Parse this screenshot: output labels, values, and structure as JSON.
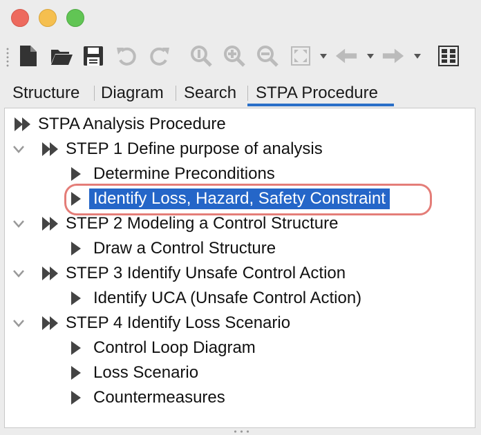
{
  "window": {
    "title_lights": [
      "close",
      "minimize",
      "zoom"
    ]
  },
  "toolbar": {
    "buttons": [
      {
        "name": "new-file-icon",
        "enabled": true
      },
      {
        "name": "open-folder-icon",
        "enabled": true
      },
      {
        "name": "save-icon",
        "enabled": true
      },
      {
        "name": "undo-icon",
        "enabled": false
      },
      {
        "name": "redo-icon",
        "enabled": false
      },
      {
        "name": "zoom-reset-icon",
        "enabled": false
      },
      {
        "name": "zoom-in-icon",
        "enabled": false
      },
      {
        "name": "zoom-out-icon",
        "enabled": false
      },
      {
        "name": "fit-to-window-icon",
        "enabled": false
      },
      {
        "name": "back-icon",
        "enabled": false
      },
      {
        "name": "forward-icon",
        "enabled": false
      },
      {
        "name": "hierarchy-icon",
        "enabled": true
      }
    ]
  },
  "tabs": [
    {
      "label": "Structure",
      "active": false
    },
    {
      "label": "Diagram",
      "active": false
    },
    {
      "label": "Search",
      "active": false
    },
    {
      "label": "STPA Procedure",
      "active": true
    }
  ],
  "tree": {
    "root": "STPA Analysis Procedure",
    "steps": [
      {
        "label": "STEP 1 Define purpose of analysis",
        "expanded": true,
        "children": [
          "Determine Preconditions",
          "Identify Loss, Hazard, Safety Constraint"
        ]
      },
      {
        "label": "STEP 2 Modeling a Control Structure",
        "expanded": true,
        "children": [
          "Draw a Control Structure"
        ]
      },
      {
        "label": "STEP 3 Identify Unsafe Control Action",
        "expanded": true,
        "children": [
          "Identify UCA (Unsafe Control Action)"
        ]
      },
      {
        "label": "STEP 4 Identify Loss Scenario",
        "expanded": true,
        "children": [
          "Control Loop Diagram",
          "Loss Scenario",
          "Countermeasures"
        ]
      }
    ],
    "selected_item": "Identify Loss, Hazard, Safety Constraint"
  },
  "colors": {
    "selection": "#2566c8",
    "highlight_ring": "#e47d78",
    "active_tab_underline": "#2a6fc8"
  }
}
